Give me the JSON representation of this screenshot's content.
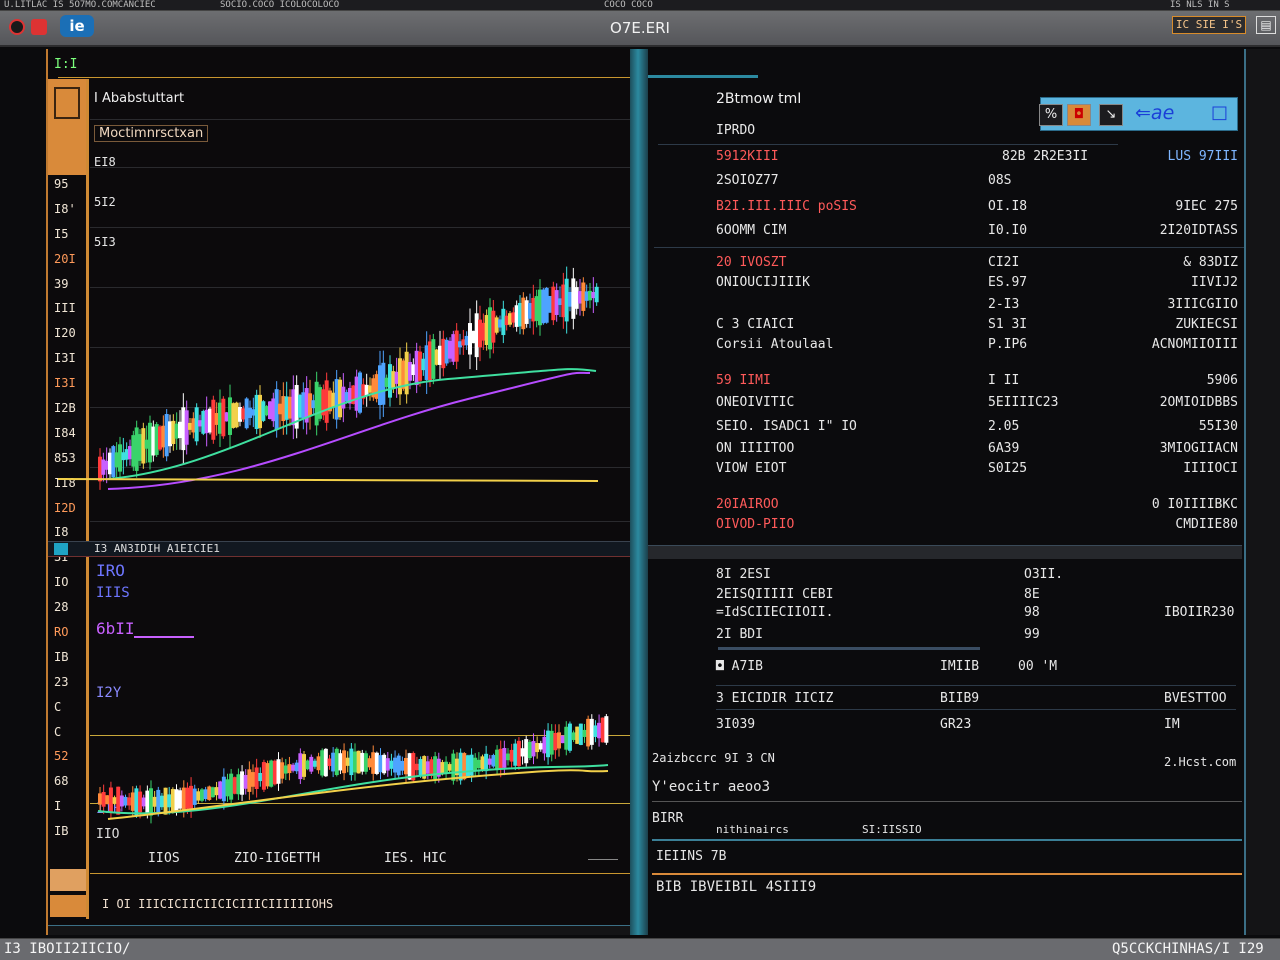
{
  "topstrip": {
    "left_text": "U.LITLAC IS 5O7MO.COMCANCIEC",
    "mid_text": "SOCIO.COCO ICOLOCOLOCO",
    "center_text": "COCO COCO",
    "right_text": "IS NLS IN S"
  },
  "titlebar": {
    "title": "O7E.ERI",
    "badge": "IC SIE I'S",
    "app_icon": "ie"
  },
  "left": {
    "header": "I:I",
    "chart_title_1": "I Ababstuttart",
    "chart_title_2": "Moctimnrsctxan",
    "label_ei": "EI8",
    "label_512": "5I2",
    "label_513": "5I3",
    "y_ticks": [
      "95",
      "I8'",
      "I5",
      "20I",
      "39",
      "III",
      "I20",
      "I3I",
      "I3I",
      "I2B",
      "I84",
      "853",
      "II8",
      "I2D",
      "I8",
      "3I",
      "IO",
      "28",
      "RO",
      "IB",
      "23",
      "C",
      "C",
      "52",
      "68",
      "I",
      "IB"
    ],
    "sep_label": "I3 AN3IDIH A1EICIE1",
    "lower_labels": {
      "a": "IRO",
      "b": "IIIS",
      "c": "6bII",
      "d": "I2Y",
      "e": "IIB",
      "f": "IIO"
    },
    "x_labels": [
      "II",
      "OS",
      "ZIO-IIGETTH",
      "IES. HIC"
    ],
    "footer": "I OI IIICICIICIICICIIICIIIIIIOHS"
  },
  "right": {
    "title": "2Btmow tmI",
    "rows": [
      {
        "l": "IPRDO",
        "m": "",
        "r": ""
      },
      {
        "l": "5912KIII",
        "m": "82B 2R2E3II",
        "r": "LUS 97III"
      },
      {
        "l": "2SOIOZ77",
        "m": "08S",
        "r": ""
      },
      {
        "l": "B2I.III.IIIC poSIS",
        "m": "OI.I8",
        "r": "9IEC 275"
      },
      {
        "l": "6OOMM CIM",
        "m": "I0.I0",
        "r": "2I20IDTASS"
      },
      {
        "l": "20 IVOSZT",
        "m": "CI2I",
        "r": "& 83DIZ"
      },
      {
        "l": "ONIOUCIJIIIK",
        "m": "ES.97",
        "r": "IIVIJ2"
      },
      {
        "l": "",
        "m": "2-I3",
        "r": "3IIICGIIO"
      },
      {
        "l": "C 3 CIAICI",
        "m": "S1 3I",
        "r": "ZUKIECSI"
      },
      {
        "l": "Corsii Atoulaal",
        "m": "P.IP6",
        "r": "ACNOMIIOIII"
      },
      {
        "l": "59 IIMI",
        "m": "I II",
        "r": "5906"
      },
      {
        "l": "ONEOIVITIC",
        "m": "5EIIIIC23",
        "r": "2OMIOIDBBS"
      },
      {
        "l": "SEIO. ISADC1 I\" IO",
        "m": "2.05",
        "r": "55I30"
      },
      {
        "l": "ON IIIITOO",
        "m": "6A39",
        "r": "3MIOGIIACN"
      },
      {
        "l": "VIOW EIOT",
        "m": "S0I25",
        "r": "IIIIOCI"
      },
      {
        "l": "20IAIROO",
        "m": "",
        "r": "0 I0IIIIBKC"
      },
      {
        "l": "OIVOD-PIIO",
        "m": "",
        "r": "CMDIIE80"
      }
    ],
    "toolbar": {
      "b1": "%",
      "b2": "◘",
      "b3": "↘",
      "word": "⇐ae",
      "square": "□"
    },
    "lower": {
      "rows": [
        {
          "l": "8I 2ESI",
          "m": "O3II.",
          "r": ""
        },
        {
          "l": "2EISQIIIII CEBI",
          "m": "8E",
          "r": ""
        },
        {
          "l": "=IdSCIIECIIOII.",
          "m": "98",
          "r": "IBOIIR230"
        },
        {
          "l": "2I BDI",
          "m": "99",
          "r": ""
        },
        {
          "l": "◘ A7IB",
          "m": "IMIIB",
          "r": "00 'M"
        },
        {
          "l": "3 EICIDIR IICIZ",
          "m": "BIIB9",
          "r": "BVESTTOO"
        },
        {
          "l": "3I039",
          "m": "GR23",
          "r": "IM"
        }
      ],
      "footer1": "2aizbccrc 9I 3 CN",
      "footer1_r": "2.Hcst.com",
      "footer2": "Y'eocitr aeoo3",
      "footer3_a": "BIRR",
      "footer3_b": "nithinaircs",
      "footer3_c": "SI:IISSIO",
      "tab": "IEIINS 7B",
      "status": "BIB IBVEIBIL 4SIII9"
    }
  },
  "bottom": {
    "left": "I3 IBOII2IICIO/",
    "right": "Q5CCKCHINHAS/I I29"
  },
  "colors": {
    "accent_orange": "#d98a3a",
    "accent_teal": "#2c8aa0",
    "up": "#3ad36b",
    "down": "#ff3b3b",
    "ma_green": "#3fe0a0",
    "ma_purple": "#b64cff",
    "ma_yellow": "#f2d04a"
  },
  "icons": [
    "record-icon",
    "stop-icon",
    "app-logo-icon",
    "scissors-icon",
    "record-square-icon",
    "arrow-icon",
    "panel-icon",
    "window-icon"
  ]
}
